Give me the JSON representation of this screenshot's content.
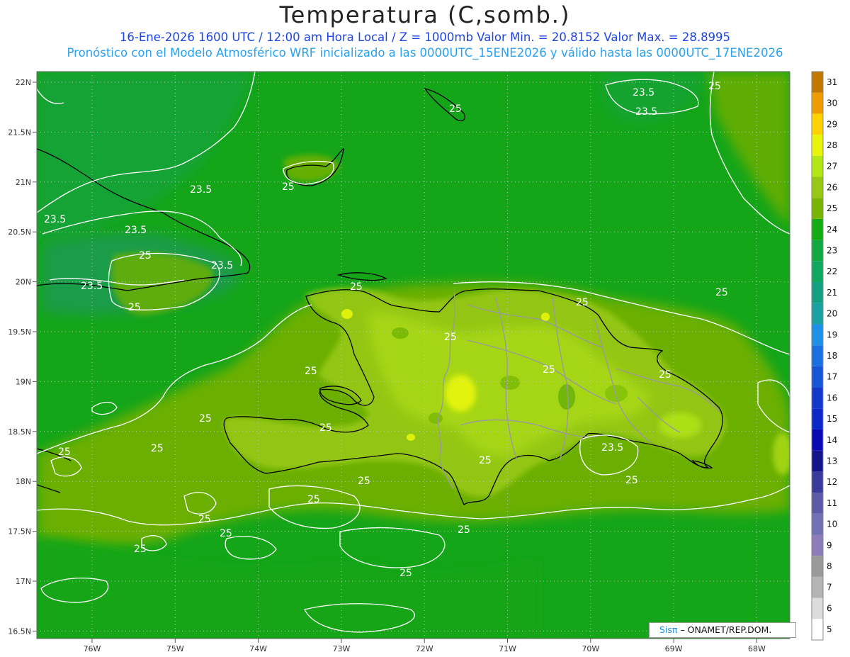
{
  "title": "Temperatura (C,somb.)",
  "subtitle_line1": "16-Ene-2026 1600 UTC / 12:00 am Hora Local / Z = 1000mb   Valor Min. = 20.8152   Valor Max. = 28.8995",
  "subtitle_line2": "Pronóstico con el Modelo Atmosférico WRF inicializado a las 0000UTC_15ENE2026 y válido hasta las  0000UTC_17ENE2026",
  "lat_labels": [
    "22N",
    "21.5N",
    "21N",
    "20.5N",
    "20N",
    "19.5N",
    "19N",
    "18.5N",
    "18N",
    "17.5N",
    "17N",
    "16.5N"
  ],
  "lon_labels": [
    "76W",
    "75W",
    "74W",
    "73W",
    "72W",
    "71W",
    "70W",
    "69W",
    "68W"
  ],
  "colorbar": {
    "levels": [
      "5",
      "6",
      "7",
      "8",
      "9",
      "10",
      "11",
      "12",
      "13",
      "14",
      "15",
      "16",
      "17",
      "18",
      "19",
      "20",
      "21",
      "22",
      "23",
      "24",
      "25",
      "26",
      "27",
      "28",
      "29",
      "30",
      "31"
    ],
    "colors": [
      "#ffffff",
      "#dcdcdc",
      "#b4b4b4",
      "#9a9a9a",
      "#8c7cba",
      "#7070b4",
      "#5a5aa8",
      "#3a3a9c",
      "#14148c",
      "#0a0ab4",
      "#0d28c8",
      "#1438cc",
      "#1656d6",
      "#1a70e0",
      "#1e90e8",
      "#1aa0a0",
      "#12a080",
      "#10a860",
      "#12a840",
      "#14ac14",
      "#78b400",
      "#96c814",
      "#b4e614",
      "#e6f50a",
      "#ffd200",
      "#ee9c00",
      "#c07800"
    ]
  },
  "contour_labels": [
    "23.5",
    "25"
  ],
  "credit": {
    "brand": "Sisπ",
    "text": "– ONAMET/REP.DOM."
  }
}
